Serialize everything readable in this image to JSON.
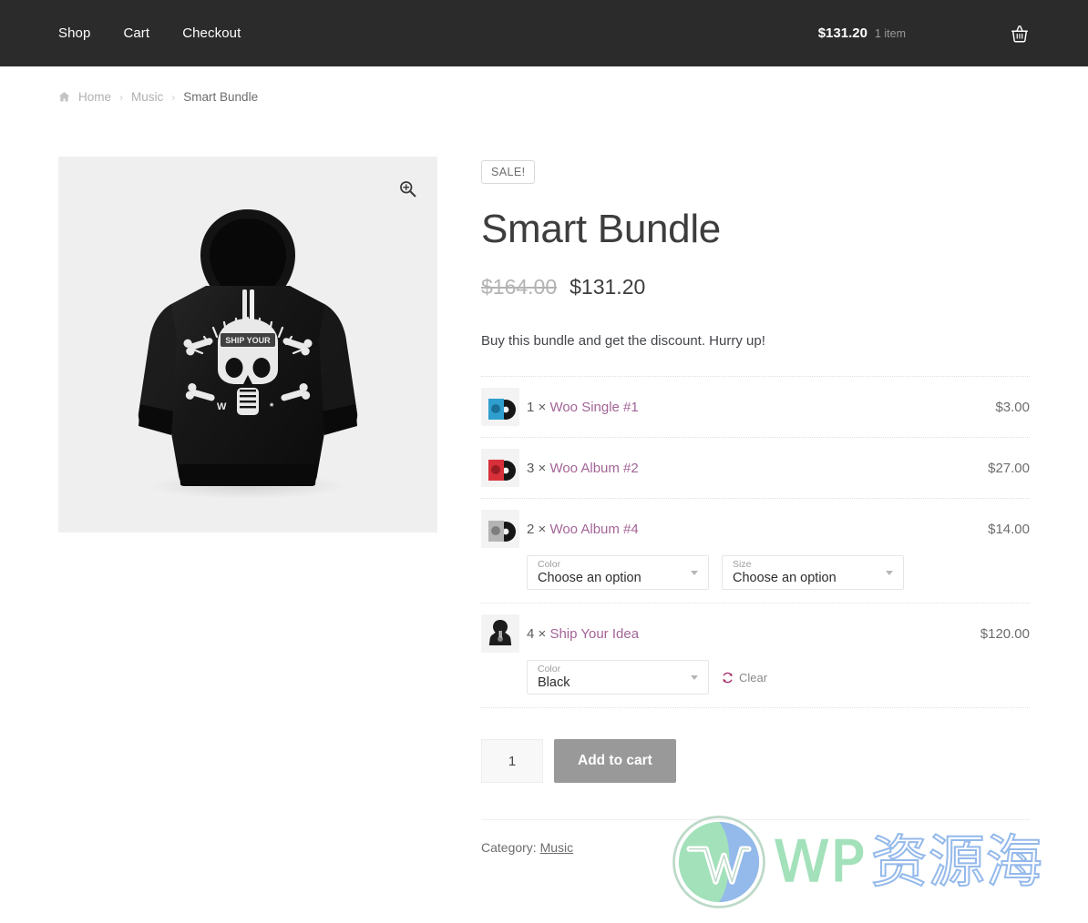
{
  "header": {
    "nav": [
      {
        "label": "Shop",
        "name": "nav-shop"
      },
      {
        "label": "Cart",
        "name": "nav-cart"
      },
      {
        "label": "Checkout",
        "name": "nav-checkout"
      }
    ],
    "cart": {
      "amount": "$131.20",
      "count": "1 item",
      "icon": "shopping-basket-icon"
    },
    "background_color": "#2b2b2b"
  },
  "breadcrumb": {
    "home_icon": "home-icon",
    "items": [
      {
        "label": "Home",
        "current": false
      },
      {
        "label": "Music",
        "current": false
      },
      {
        "label": "Smart Bundle",
        "current": true
      }
    ],
    "separator": "›"
  },
  "gallery": {
    "zoom_icon": "magnifier-plus-icon",
    "image_alt": "Black hoodie with Ship Your Idea skull print",
    "background_color": "#efefef"
  },
  "product": {
    "sale_badge": "SALE!",
    "title": "Smart Bundle",
    "price_old": "$164.00",
    "price_new": "$131.20",
    "description": "Buy this bundle and get the discount. Hurry up!",
    "link_color": "#a46497"
  },
  "bundle": {
    "items": [
      {
        "qty": "1 ×",
        "name": "Woo Single #1",
        "price": "$3.00",
        "thumb": "vinyl-blue-thumbnail",
        "variations": []
      },
      {
        "qty": "3 ×",
        "name": "Woo Album #2",
        "price": "$27.00",
        "thumb": "vinyl-red-thumbnail",
        "variations": []
      },
      {
        "qty": "2 ×",
        "name": "Woo Album #4",
        "price": "$14.00",
        "thumb": "vinyl-grey-thumbnail",
        "variations": [
          {
            "label": "Color",
            "value": "Choose an option"
          },
          {
            "label": "Size",
            "value": "Choose an option"
          }
        ],
        "clear": null
      },
      {
        "qty": "4 ×",
        "name": "Ship Your Idea",
        "price": "$120.00",
        "thumb": "hoodie-thumbnail",
        "variations": [
          {
            "label": "Color",
            "value": "Black"
          }
        ],
        "clear": {
          "label": "Clear",
          "icon": "refresh-icon"
        }
      }
    ]
  },
  "cart_form": {
    "quantity": "1",
    "quantity_placeholder": "1",
    "add_to_cart_label": "Add to cart",
    "button_color": "#999999"
  },
  "meta": {
    "category_label": "Category:",
    "category_value": "Music"
  },
  "watermark": {
    "latin": "WP",
    "cjk": "资源海",
    "logo": "wordpress-logo-icon"
  }
}
